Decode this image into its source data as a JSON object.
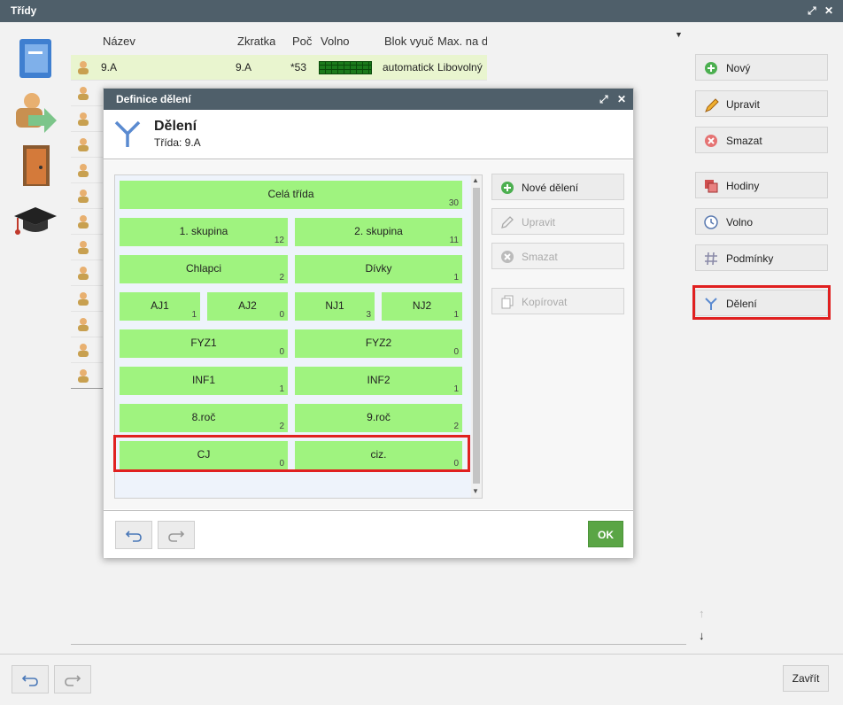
{
  "window": {
    "title": "Třídy"
  },
  "grid": {
    "columns": [
      "Název",
      "Zkratka",
      "Poč",
      "Volno",
      "Blok vyuč",
      "Max. na d"
    ],
    "selected_row": {
      "name": "9.A",
      "abbr": "9.A",
      "count": "*53",
      "block": "automatick",
      "max": "Libovolný"
    }
  },
  "sidebar_right": {
    "new": "Nový",
    "edit": "Upravit",
    "delete": "Smazat",
    "hours": "Hodiny",
    "free": "Volno",
    "conditions": "Podmínky",
    "division": "Dělení"
  },
  "modal": {
    "title": "Definice dělení",
    "heading": "Dělení",
    "subheading": "Třída: 9.A",
    "buttons": {
      "new_division": "Nové dělení",
      "edit": "Upravit",
      "delete": "Smazat",
      "copy": "Kopírovat",
      "ok": "OK"
    },
    "groups": [
      {
        "label": "Celá třída",
        "count": "30"
      },
      {
        "label": "1. skupina",
        "count": "12"
      },
      {
        "label": "2. skupina",
        "count": "11"
      },
      {
        "label": "Chlapci",
        "count": "2"
      },
      {
        "label": "Dívky",
        "count": "1"
      },
      {
        "label": "AJ1",
        "count": "1"
      },
      {
        "label": "AJ2",
        "count": "0"
      },
      {
        "label": "NJ1",
        "count": "3"
      },
      {
        "label": "NJ2",
        "count": "1"
      },
      {
        "label": "FYZ1",
        "count": "0"
      },
      {
        "label": "FYZ2",
        "count": "0"
      },
      {
        "label": "INF1",
        "count": "1"
      },
      {
        "label": "INF2",
        "count": "1"
      },
      {
        "label": "8.roč",
        "count": "2"
      },
      {
        "label": "9.roč",
        "count": "2"
      },
      {
        "label": "CJ",
        "count": "0"
      },
      {
        "label": "ciz.",
        "count": "0"
      }
    ]
  },
  "footer": {
    "close": "Zavřít"
  },
  "colors": {
    "header": "#4f5f6a",
    "group_green": "#9ff37f",
    "ok_green": "#5aa545",
    "highlight_red": "#e02020"
  }
}
